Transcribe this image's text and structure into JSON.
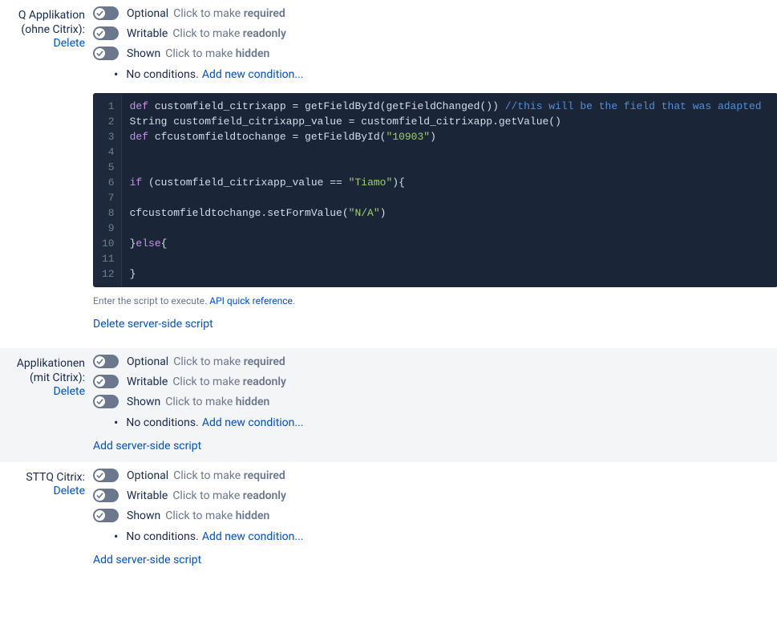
{
  "common": {
    "delete": "Delete",
    "toggle_optional": "Optional",
    "toggle_optional_hint_prefix": "Click to make ",
    "toggle_optional_hint_strong": "required",
    "toggle_writable": "Writable",
    "toggle_writable_hint_prefix": "Click to make ",
    "toggle_writable_hint_strong": "readonly",
    "toggle_shown": "Shown",
    "toggle_shown_hint_prefix": "Click to make ",
    "toggle_shown_hint_strong": "hidden",
    "no_conditions": "No conditions.",
    "add_condition": "Add new condition...",
    "add_server_script": "Add server-side script",
    "delete_server_script": "Delete server-side script",
    "script_hint": "Enter the script to execute. ",
    "api_ref": "API quick reference"
  },
  "fields": [
    {
      "title_line1": "Q Applikation",
      "title_line2": "(ohne Citrix):"
    },
    {
      "title_line1": "Applikationen",
      "title_line2": "(mit Citrix):"
    },
    {
      "title_line1": "STTQ Citrix:",
      "title_line2": ""
    }
  ],
  "code": {
    "lines": [
      {
        "n": "1",
        "segments": [
          {
            "t": "def",
            "c": "kw"
          },
          {
            "t": " customfield_citrixapp = getFieldById(getFieldChanged()) "
          },
          {
            "t": "//this will be the field that was adapted",
            "c": "cmt"
          }
        ]
      },
      {
        "n": "2",
        "segments": [
          {
            "t": "String customfield_citrixapp_value = customfield_citrixapp.getValue()"
          }
        ]
      },
      {
        "n": "3",
        "segments": [
          {
            "t": "def",
            "c": "kw"
          },
          {
            "t": " cfcustomfieldtochange = getFieldById("
          },
          {
            "t": "\"10903\"",
            "c": "str"
          },
          {
            "t": ")"
          }
        ]
      },
      {
        "n": "4",
        "segments": [
          {
            "t": ""
          }
        ]
      },
      {
        "n": "5",
        "segments": [
          {
            "t": ""
          }
        ]
      },
      {
        "n": "6",
        "segments": [
          {
            "t": "if",
            "c": "kw"
          },
          {
            "t": " (customfield_citrixapp_value == "
          },
          {
            "t": "\"Tiamo\"",
            "c": "str"
          },
          {
            "t": "){"
          }
        ]
      },
      {
        "n": "7",
        "segments": [
          {
            "t": ""
          }
        ]
      },
      {
        "n": "8",
        "segments": [
          {
            "t": "cfcustomfieldtochange.setFormValue("
          },
          {
            "t": "\"N/A\"",
            "c": "str"
          },
          {
            "t": ")"
          }
        ]
      },
      {
        "n": "9",
        "segments": [
          {
            "t": ""
          }
        ]
      },
      {
        "n": "10",
        "segments": [
          {
            "t": "}"
          },
          {
            "t": "else",
            "c": "kw"
          },
          {
            "t": "{"
          }
        ]
      },
      {
        "n": "11",
        "segments": [
          {
            "t": ""
          }
        ]
      },
      {
        "n": "12",
        "segments": [
          {
            "t": "}"
          }
        ]
      }
    ]
  }
}
